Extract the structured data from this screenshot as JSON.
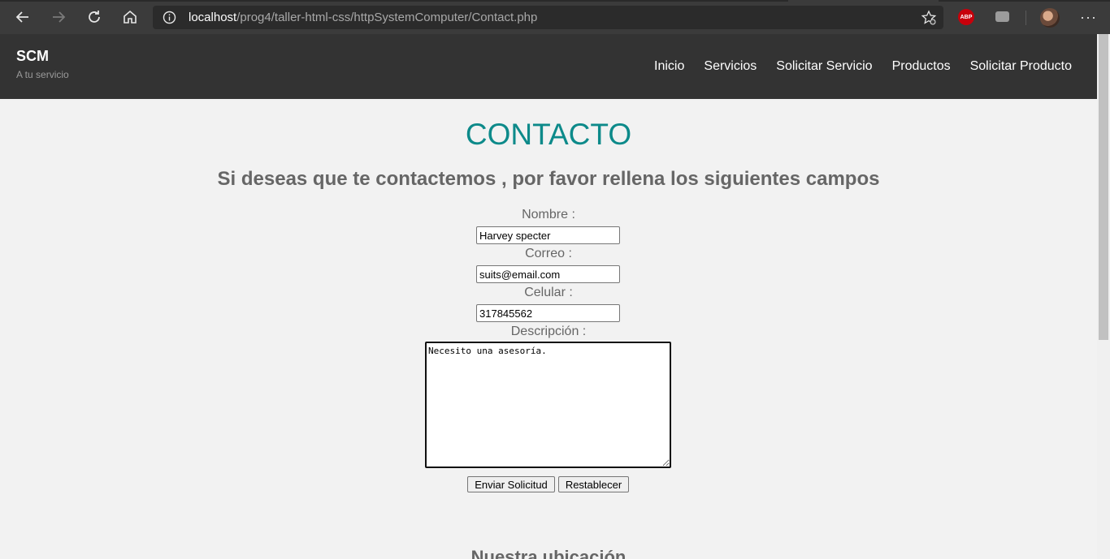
{
  "browser": {
    "url_host": "localhost",
    "url_path": "/prog4/taller-html-css/httpSystemComputer/Contact.php",
    "extension_abp_label": "ABP",
    "more_label": "···",
    "icons": [
      "back-icon",
      "forward-icon",
      "reload-icon",
      "home-icon",
      "info-icon",
      "favorite-star-icon",
      "adblock-icon",
      "extension-icon",
      "avatar",
      "more-icon"
    ]
  },
  "site": {
    "brand": "SCM",
    "tagline": "A tu servicio",
    "nav": [
      "Inicio",
      "Servicios",
      "Solicitar Servicio",
      "Productos",
      "Solicitar Producto"
    ]
  },
  "main": {
    "title": "CONTACTO",
    "subtitle": "Si deseas que te contactemos , por favor rellena los siguientes campos",
    "form": {
      "name_label": "Nombre :",
      "name_value": "Harvey specter",
      "email_label": "Correo :",
      "email_value": "suits@email.com",
      "phone_label": "Celular :",
      "phone_value": "317845562",
      "description_label": "Descripción :",
      "description_value": "Necesito una asesoría.",
      "submit_label": "Enviar Solicitud",
      "reset_label": "Restablecer"
    },
    "location_heading": "Nuestra ubicación"
  },
  "colors": {
    "title": "#0d8a8a",
    "header_bg": "#333333",
    "page_bg": "#f2f2f2",
    "muted_text": "#666666"
  }
}
